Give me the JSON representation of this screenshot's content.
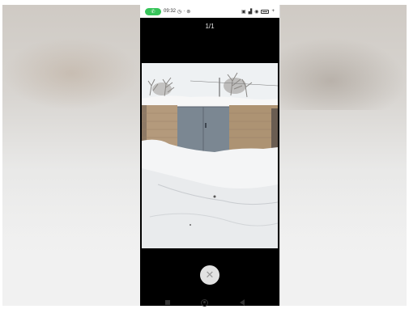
{
  "statusbar": {
    "call_badge": "",
    "time": "09:32",
    "alarm_icon": "alarm-icon",
    "right_icons": [
      "nfc-icon",
      "signal-icon",
      "wifi-icon",
      "battery-icon"
    ]
  },
  "viewer": {
    "counter": "1/1",
    "close_icon": "close-icon",
    "photo_subject": "garage-photo"
  },
  "navigation": {
    "buttons": [
      "recents-button",
      "home-button",
      "back-button"
    ]
  }
}
